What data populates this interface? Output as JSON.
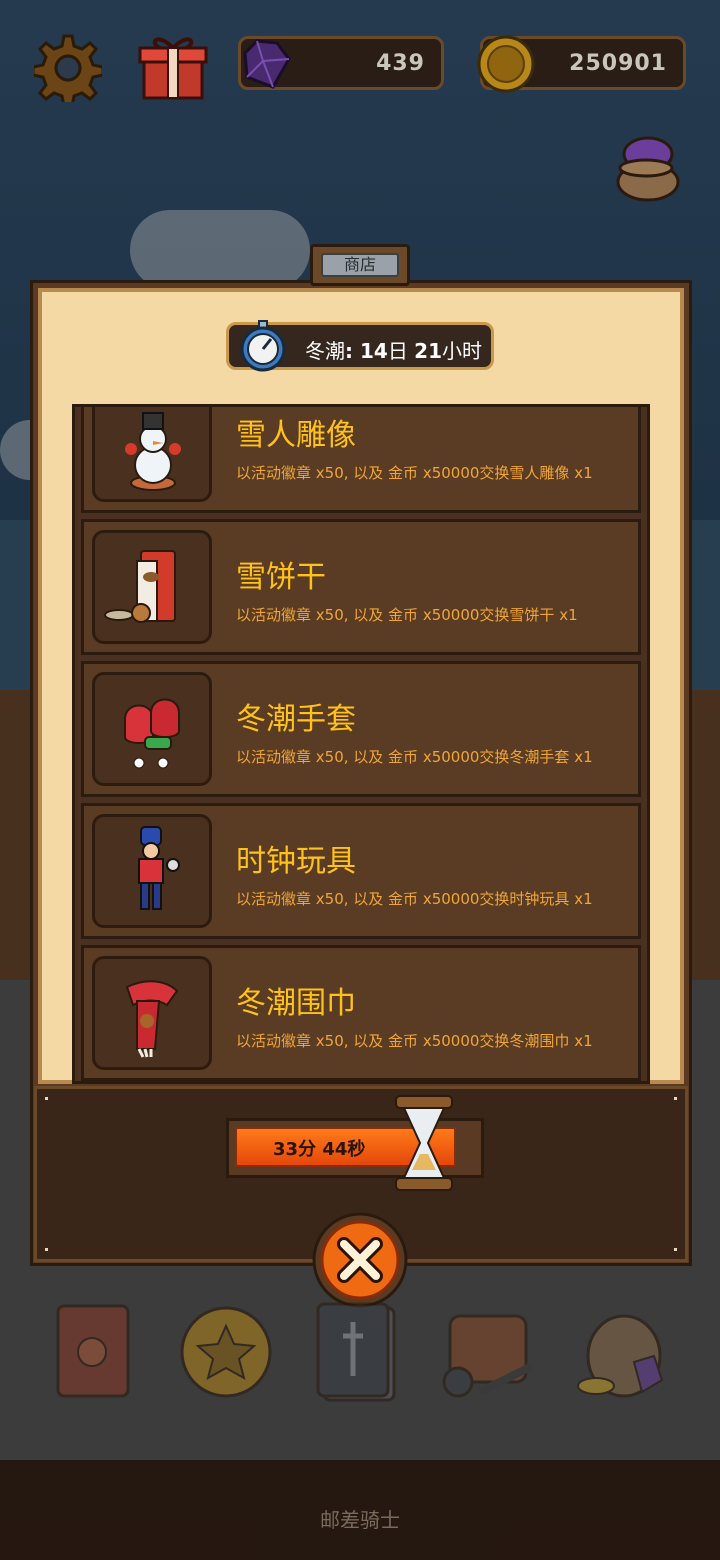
{
  "top_bar": {
    "gems": "439",
    "coins": "250901"
  },
  "shop": {
    "tab_label": "商店",
    "timer": {
      "label": "冬潮",
      "days": "14",
      "days_unit": "日",
      "hours": "21",
      "hours_unit": "小时"
    },
    "items": [
      {
        "name": "雪人雕像",
        "desc_prefix": "以活动徽章 x50, 以及 ",
        "desc_gold": "金币 x50000",
        "desc_suffix": "交换雪人雕像 x1",
        "icon": "snowman-icon"
      },
      {
        "name": "雪饼干",
        "desc_prefix": "以活动徽章 x50, 以及 ",
        "desc_gold": "金币 x50000",
        "desc_suffix": "交换雪饼干 x1",
        "icon": "cookie-bag-icon"
      },
      {
        "name": "冬潮手套",
        "desc_prefix": "以活动徽章 x50, 以及 ",
        "desc_gold": "金币 x50000",
        "desc_suffix": "交换冬潮手套 x1",
        "icon": "mittens-icon"
      },
      {
        "name": "时钟玩具",
        "desc_prefix": "以活动徽章 x50, 以及 ",
        "desc_gold": "金币 x50000",
        "desc_suffix": "交换时钟玩具 x1",
        "icon": "toy-soldier-icon"
      },
      {
        "name": "冬潮围巾",
        "desc_prefix": "以活动徽章 x50, 以及 ",
        "desc_gold": "金币 x50000",
        "desc_suffix": "交换冬潮围巾 x1",
        "icon": "scarf-icon"
      }
    ],
    "refresh": {
      "text": "33分 44秒",
      "progress_fraction": 0.92
    }
  },
  "footer": {
    "title": "邮差骑士"
  },
  "colors": {
    "item_name": "#ffc21a",
    "item_desc": "#f0a636",
    "progress": "#ff7a1a"
  }
}
